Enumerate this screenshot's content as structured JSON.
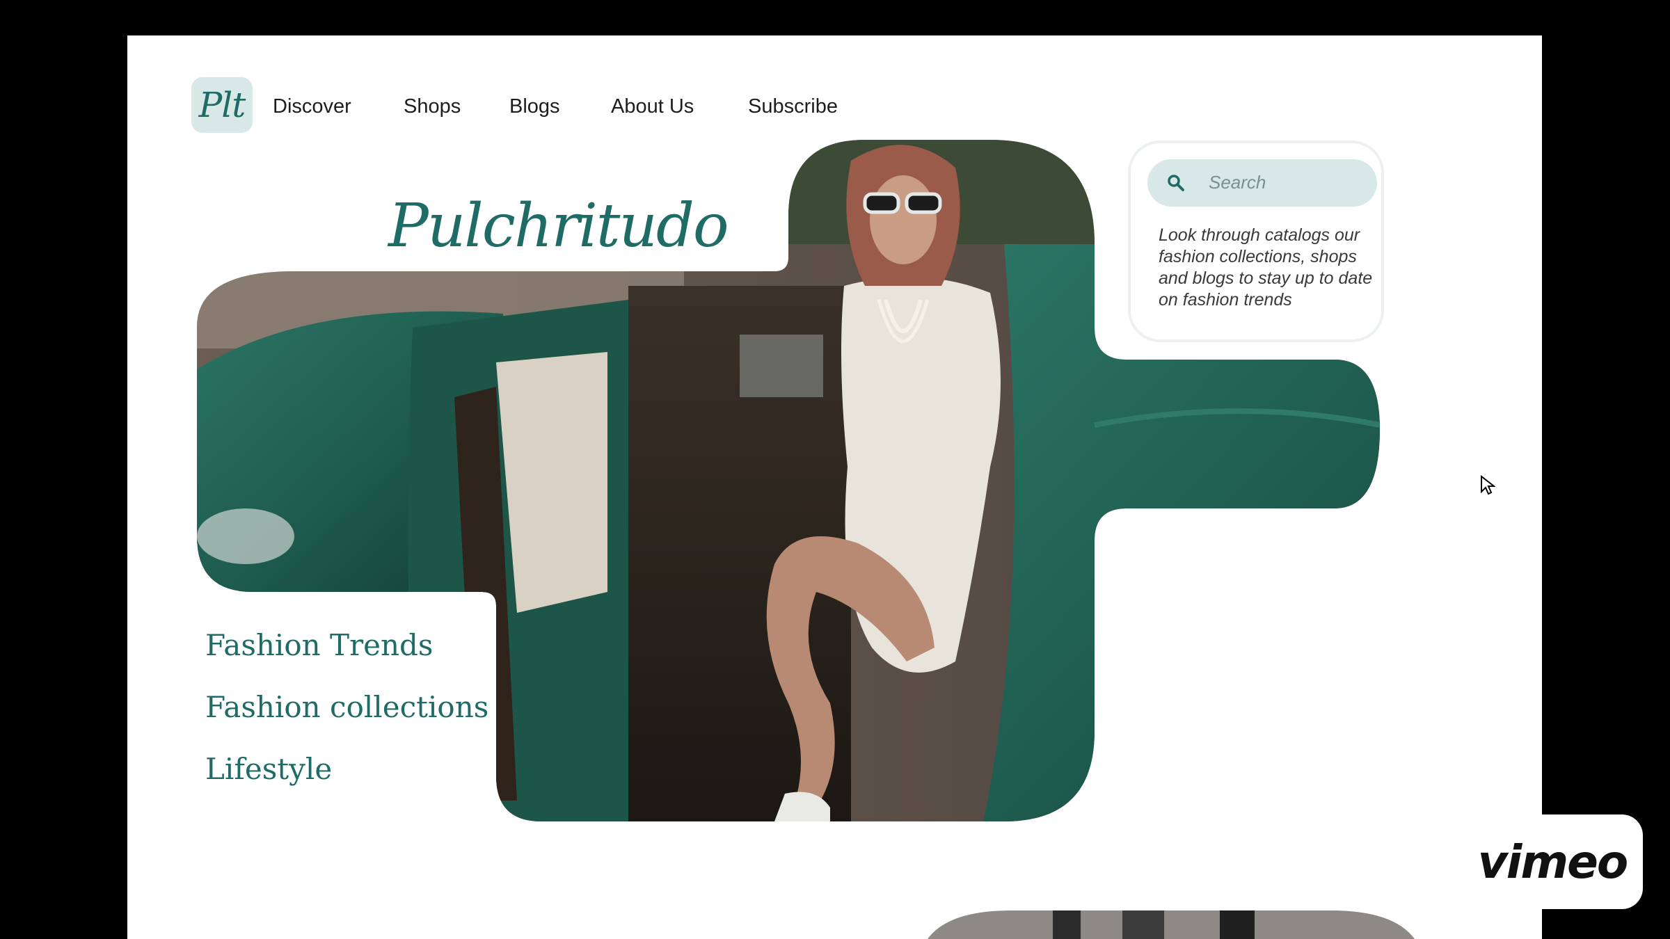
{
  "logo": {
    "text": "Plt"
  },
  "nav": {
    "items": [
      {
        "label": "Discover"
      },
      {
        "label": "Shops"
      },
      {
        "label": "Blogs"
      },
      {
        "label": "About Us"
      },
      {
        "label": "Subscribe"
      }
    ]
  },
  "hero": {
    "brand": "Pulchritudo"
  },
  "categories": [
    {
      "label": "Fashion Trends"
    },
    {
      "label": "Fashion collections"
    },
    {
      "label": "Lifestyle"
    }
  ],
  "search": {
    "placeholder": "Search",
    "description": "Look through catalogs our fashion collections, shops and blogs to stay up to date on fashion trends"
  },
  "badge": {
    "label": "vimeo"
  },
  "colors": {
    "accent": "#1f6b66",
    "accent_light": "#d7e8e6",
    "car_green": "#1e5c4f",
    "background": "#ffffff",
    "frame": "#000000"
  },
  "icons": [
    "search-icon",
    "cursor-pointer-icon"
  ]
}
